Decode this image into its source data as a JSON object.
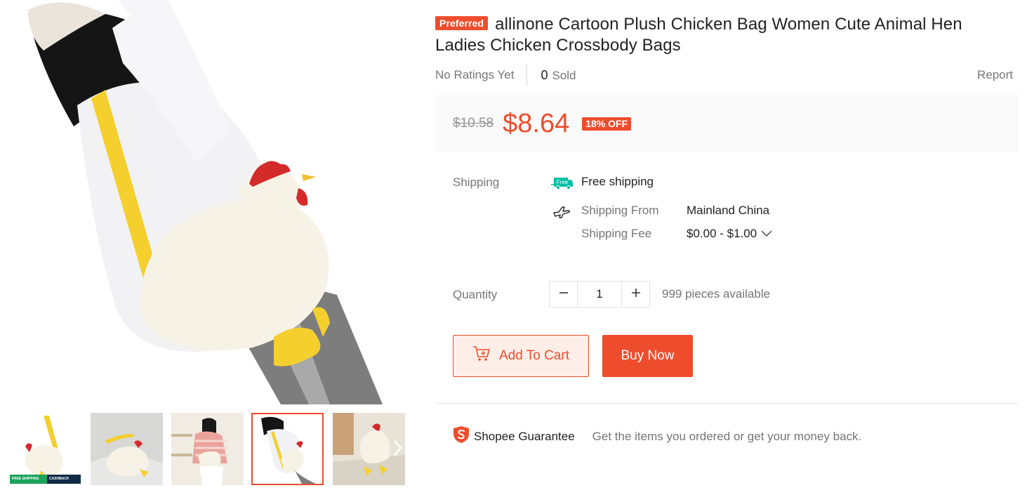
{
  "gallery": {
    "main_image": "chicken-bag-photo",
    "thumbnails": [
      "chicken-bag-thumb-1",
      "chicken-bag-thumb-2",
      "chicken-bag-thumb-3",
      "chicken-bag-thumb-4",
      "chicken-bag-thumb-5"
    ],
    "active_thumbnail": 4,
    "next_icon": "chevron-right-icon",
    "promo_badge": {
      "left": "FREE SHIPPING VOUCHER",
      "right": "CASHBACK VOUCHERS"
    }
  },
  "product": {
    "badge": "Preferred",
    "title": "allinone Cartoon Plush Chicken Bag Women Cute Animal Hen Ladies Chicken Crossbody Bags",
    "rating_text": "No Ratings Yet",
    "sold_count": "0",
    "sold_label": "Sold",
    "report_label": "Report"
  },
  "price": {
    "original": "$10.58",
    "current": "$8.64",
    "discount": "18% OFF"
  },
  "shipping": {
    "label": "Shipping",
    "free_icon_text": "Free",
    "free_text": "Free shipping",
    "from_label": "Shipping From",
    "from_value": "Mainland China",
    "fee_label": "Shipping Fee",
    "fee_value": "$0.00 - $1.00"
  },
  "quantity": {
    "label": "Quantity",
    "value": "1",
    "available": "999 pieces available"
  },
  "actions": {
    "add_to_cart": "Add To Cart",
    "buy_now": "Buy Now"
  },
  "guarantee": {
    "title": "Shopee Guarantee",
    "text": "Get the items you ordered or get your money back."
  },
  "colors": {
    "brand": "#ee4d2d",
    "free_shipping": "#00bfa5"
  }
}
